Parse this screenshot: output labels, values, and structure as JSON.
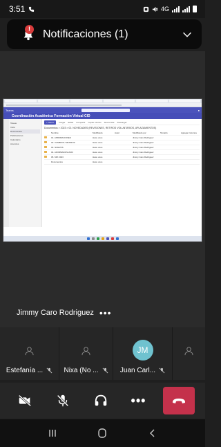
{
  "status_bar": {
    "time": "3:51",
    "network": "4G"
  },
  "notification": {
    "title": "Notificaciones (1)",
    "badge_count": "!"
  },
  "shared_screen": {
    "team_name": "Coordinación Académica Formación Virtual CID",
    "app_brand": "Teams",
    "nav_items": [
      "Tareas",
      "Inicio",
      "Documentos",
      "Publicaciones",
      "Calendario",
      "Anuncios"
    ],
    "toolbar": {
      "new": "+ Nuevo",
      "items": [
        "Cargar",
        "Editar",
        "Compartir",
        "Copiar vínculo",
        "Sincronizar",
        "Descargar"
      ]
    },
    "breadcrumb": "Documentos > 2023 > 02. NOVEDADES (REVISIONES, RETIROS VOLUNTARIOS, APLAZAMIENTOS)",
    "columns": [
      "",
      "Nombre",
      "Modificado",
      "Autor",
      "Modificado por",
      "Tamaño",
      "Agregar columna"
    ],
    "rows": [
      {
        "name": "01. APROBACIONES",
        "mod": "Hace unos",
        "by": "Jimmy Caro Rodriguez"
      },
      {
        "name": "02. CAMBIOS / RETIROS",
        "mod": "Hace unos",
        "by": "Jimmy Caro Rodriguez"
      },
      {
        "name": "03. NUEVOS",
        "mod": "Hace unos",
        "by": "Jimmy Caro Rodriguez"
      },
      {
        "name": "04. AFORMADOS 2023",
        "mod": "Hace unos",
        "by": "Jimmy Caro Rodriguez"
      },
      {
        "name": "05. MIX 2023",
        "mod": "Hace unos",
        "by": "Jimmy Caro Rodriguez"
      },
      {
        "name": "Documentos",
        "mod": "Hace unos",
        "by": ""
      }
    ]
  },
  "speaker": {
    "name": "Jimmy Caro Rodriguez",
    "more": "•••"
  },
  "participants": [
    {
      "name": "Estefanía ...",
      "type": "person"
    },
    {
      "name": "Nixa (No ...",
      "type": "person"
    },
    {
      "name": "Juan Carl...",
      "type": "avatar",
      "initials": "JM",
      "avatar_color": "#6fc2cf"
    },
    {
      "name": "",
      "type": "person"
    }
  ],
  "controls": {
    "more": "•••",
    "hangup_color": "#c4314b"
  },
  "colors": {
    "teams_purple": "#4b53bc",
    "background": "#1f1f1f"
  }
}
